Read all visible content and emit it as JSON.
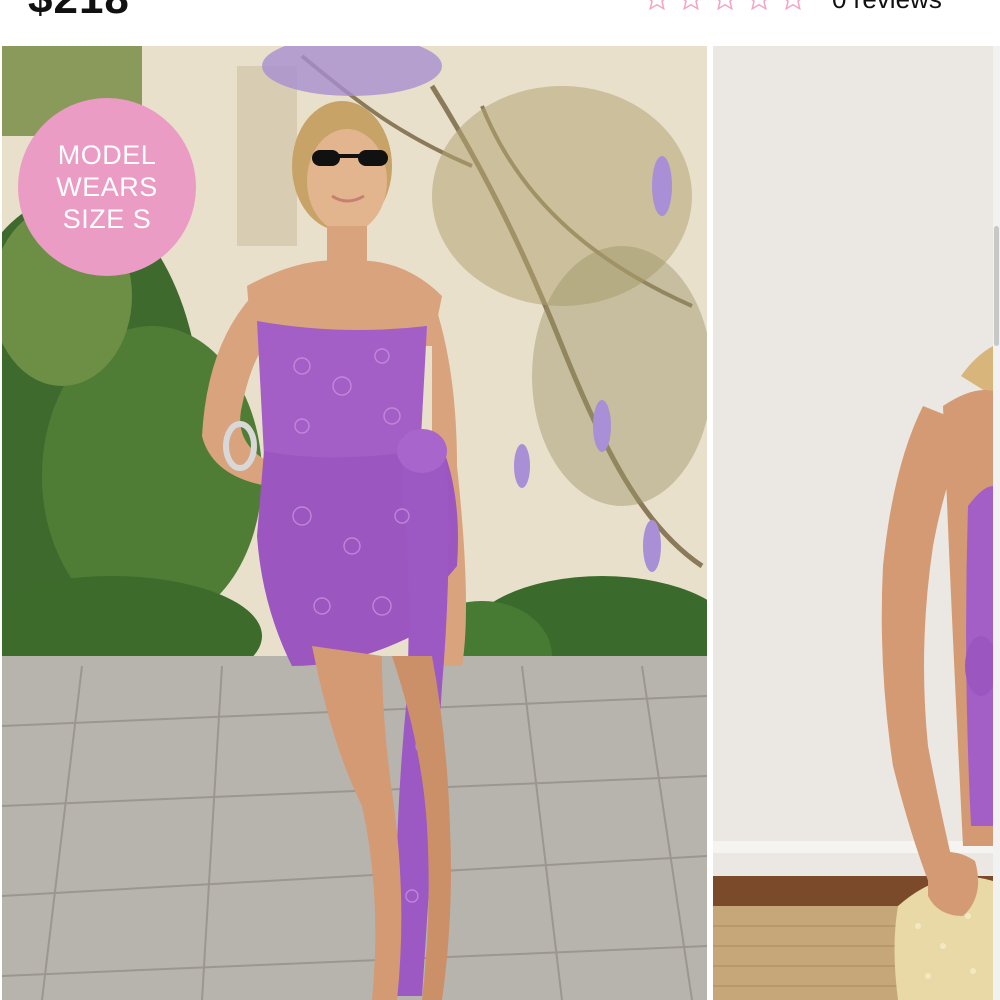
{
  "product": {
    "price": "$218",
    "rating": {
      "value": 0,
      "max": 5
    },
    "reviews_label": "0 reviews"
  },
  "gallery": {
    "badge_text": "MODEL\nWEARS\nSIZE S",
    "images": [
      {
        "icon": "product-photo-model-outdoor"
      },
      {
        "icon": "product-photo-model-studio"
      }
    ]
  },
  "colors": {
    "badge": "#ea9cc4",
    "star_outline": "#f3a6c4",
    "dress": "#a45fc7"
  }
}
